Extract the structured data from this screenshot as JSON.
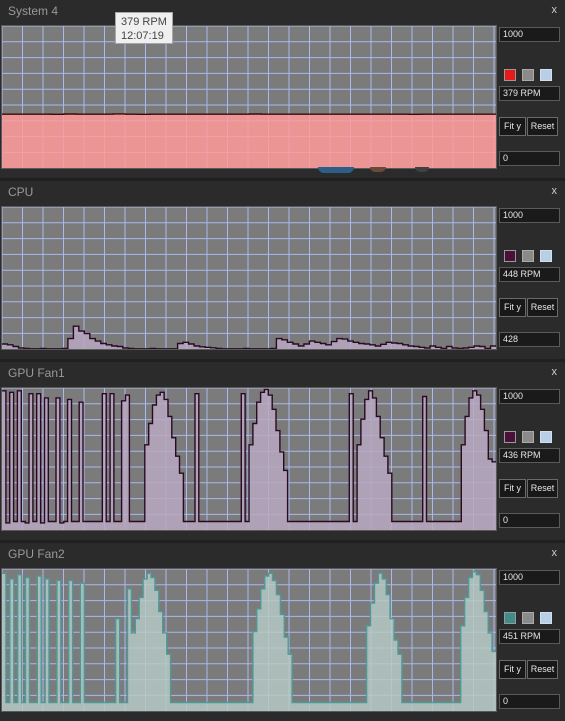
{
  "tooltip": {
    "rpm": "379 RPM",
    "time": "12:07:19"
  },
  "panels": [
    {
      "title": "System 4",
      "ymax": "1000",
      "ymin": "0",
      "rpm": "379 RPM",
      "fit": "Fit y",
      "reset": "Reset",
      "close": "x",
      "line": "#3a0a0a",
      "fill": "#ff9a9a",
      "swatch": "#e51b1b"
    },
    {
      "title": "CPU",
      "ymax": "1000",
      "ymin": "428",
      "rpm": "448 RPM",
      "fit": "Fit y",
      "reset": "Reset",
      "close": "x",
      "line": "#2a0a22",
      "fill": "#b9a8c1",
      "swatch": "#4a1038"
    },
    {
      "title": "GPU Fan1",
      "ymax": "1000",
      "ymin": "0",
      "rpm": "436 RPM",
      "fit": "Fit y",
      "reset": "Reset",
      "close": "x",
      "line": "#2a0a22",
      "fill": "#b9a8c1",
      "swatch": "#4a1038"
    },
    {
      "title": "GPU Fan2",
      "ymax": "1000",
      "ymin": "0",
      "rpm": "451 RPM",
      "fit": "Fit y",
      "reset": "Reset",
      "close": "x",
      "line": "#4f9a98",
      "fill": "#b5c9c4",
      "swatch": "#3f8d8a"
    }
  ],
  "chart_data": [
    {
      "type": "area",
      "ylim": [
        0,
        1000
      ],
      "values": [
        379,
        379,
        379,
        379,
        378,
        380,
        379,
        379,
        379,
        381,
        379,
        378,
        379,
        379,
        379,
        379,
        379,
        379,
        379,
        379,
        380,
        379,
        379,
        379,
        379,
        379,
        379,
        379,
        379,
        379,
        379,
        379,
        379,
        378,
        379,
        379,
        379,
        379,
        379,
        379
      ]
    },
    {
      "type": "area",
      "ylim": [
        428,
        1000
      ],
      "values": [
        448,
        445,
        438,
        432,
        430,
        429,
        429,
        430,
        429,
        429,
        429,
        430,
        470,
        520,
        500,
        490,
        470,
        460,
        450,
        445,
        440,
        438,
        432,
        430,
        429,
        429,
        429,
        430,
        429,
        429,
        429,
        429,
        450,
        455,
        448,
        440,
        437,
        435,
        433,
        430,
        429,
        429,
        429,
        429,
        430,
        429,
        429,
        429,
        429,
        430,
        470,
        465,
        455,
        448,
        440,
        448,
        460,
        455,
        450,
        445,
        458,
        470,
        468,
        460,
        455,
        450,
        448,
        445,
        440,
        447,
        455,
        452,
        450,
        445,
        440,
        438,
        435,
        432,
        440,
        435,
        430,
        438,
        432,
        430,
        432,
        435,
        440,
        438,
        430,
        440
      ]
    },
    {
      "type": "area",
      "ylim": [
        0,
        1000
      ],
      "values": [
        980,
        50,
        970,
        60,
        980,
        60,
        50,
        960,
        60,
        960,
        50,
        930,
        60,
        60,
        930,
        50,
        60,
        920,
        60,
        60,
        900,
        60,
        60,
        60,
        60,
        60,
        960,
        60,
        960,
        60,
        60,
        910,
        950,
        60,
        60,
        60,
        60,
        600,
        750,
        880,
        950,
        970,
        920,
        800,
        650,
        520,
        400,
        60,
        60,
        60,
        960,
        60,
        60,
        60,
        60,
        60,
        60,
        60,
        60,
        60,
        60,
        60,
        960,
        60,
        600,
        750,
        900,
        970,
        990,
        950,
        850,
        700,
        550,
        420,
        60,
        60,
        60,
        60,
        60,
        60,
        60,
        60,
        60,
        60,
        60,
        60,
        60,
        60,
        60,
        60,
        960,
        60,
        600,
        780,
        920,
        980,
        930,
        800,
        650,
        520,
        400,
        60,
        60,
        60,
        60,
        60,
        60,
        60,
        60,
        940,
        60,
        60,
        60,
        60,
        60,
        60,
        60,
        60,
        60,
        600,
        800,
        930,
        980,
        950,
        850,
        700,
        500,
        480
      ]
    },
    {
      "type": "area",
      "ylim": [
        0,
        1000
      ],
      "values": [
        970,
        60,
        930,
        60,
        960,
        60,
        940,
        60,
        60,
        950,
        60,
        930,
        60,
        60,
        920,
        60,
        60,
        920,
        60,
        60,
        900,
        60,
        60,
        60,
        60,
        60,
        60,
        60,
        60,
        650,
        60,
        60,
        860,
        550,
        650,
        800,
        930,
        970,
        940,
        850,
        700,
        550,
        400,
        60,
        60,
        60,
        60,
        60,
        60,
        60,
        60,
        60,
        60,
        60,
        60,
        60,
        60,
        60,
        60,
        60,
        60,
        60,
        60,
        60,
        560,
        720,
        860,
        950,
        970,
        920,
        820,
        680,
        520,
        400,
        60,
        60,
        60,
        60,
        60,
        60,
        60,
        60,
        60,
        60,
        60,
        60,
        60,
        60,
        60,
        60,
        60,
        60,
        60,
        600,
        760,
        900,
        970,
        930,
        820,
        650,
        500,
        400,
        60,
        60,
        60,
        60,
        60,
        60,
        60,
        60,
        60,
        60,
        60,
        60,
        60,
        60,
        60,
        600,
        800,
        940,
        980,
        960,
        850,
        700,
        550,
        420
      ]
    }
  ]
}
